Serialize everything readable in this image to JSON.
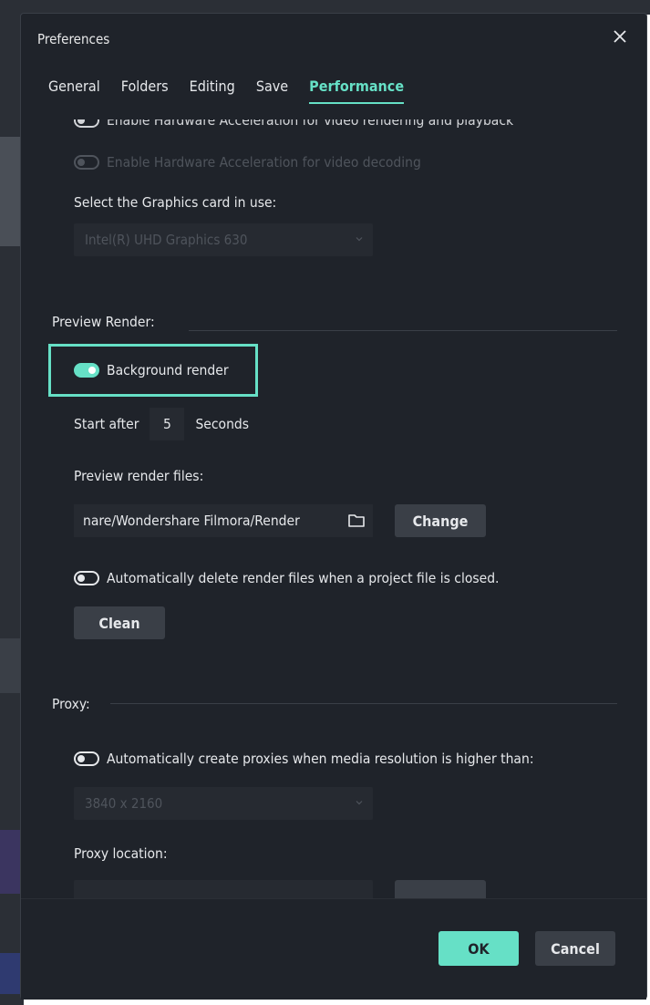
{
  "dialog": {
    "title": "Preferences"
  },
  "tabs": [
    {
      "label": "General"
    },
    {
      "label": "Folders"
    },
    {
      "label": "Editing"
    },
    {
      "label": "Save"
    },
    {
      "label": "Performance"
    }
  ],
  "active_tab": "Performance",
  "hw_accel": {
    "video_render_label": "Enable Hardware Acceleration for video rendering and playback",
    "video_decoding_label": "Enable Hardware Acceleration for video decoding",
    "graphics_card_label": "Select the Graphics card in use:",
    "graphics_card_value": "Intel(R) UHD Graphics 630"
  },
  "preview_render": {
    "section_title": "Preview Render:",
    "background_render_label": "Background render",
    "background_render_on": true,
    "start_after_label": "Start after",
    "start_after_value": "5",
    "seconds_label": "Seconds",
    "files_label": "Preview render files:",
    "path_value": "nare/Wondershare Filmora/Render",
    "change_button": "Change",
    "auto_delete_label": "Automatically delete render files when a project file is closed.",
    "clean_button": "Clean"
  },
  "proxy": {
    "section_title": "Proxy:",
    "auto_create_label": "Automatically create proxies when media resolution is higher than:",
    "resolution_value": "3840 x 2160",
    "location_label": "Proxy location:"
  },
  "footer": {
    "ok_label": "OK",
    "cancel_label": "Cancel"
  },
  "colors": {
    "accent": "#66e0c6",
    "dialog_bg": "#1f232a",
    "field_bg": "#262a31",
    "button_bg": "#3a3f47",
    "disabled_text": "#4f545c"
  }
}
